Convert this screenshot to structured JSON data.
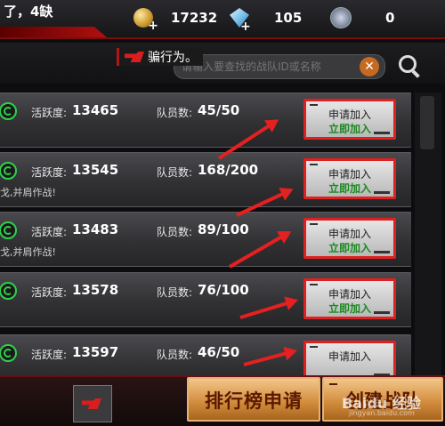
{
  "top": {
    "notice": "了，4缺",
    "gold": "17232",
    "diamond": "105",
    "medal": "0"
  },
  "search": {
    "warning": "骗行为。",
    "placeholder": "请输入要查找的战队ID或名称"
  },
  "rows": [
    {
      "activity_label": "活跃度:",
      "activity": "13465",
      "members_label": "队员数:",
      "members": "45/50",
      "desc": "",
      "apply": "申请加入",
      "join": "立即加入"
    },
    {
      "activity_label": "活跃度:",
      "activity": "13545",
      "members_label": "队员数:",
      "members": "168/200",
      "desc": "戈,并肩作战!",
      "apply": "申请加入",
      "join": "立即加入"
    },
    {
      "activity_label": "活跃度:",
      "activity": "13483",
      "members_label": "队员数:",
      "members": "89/100",
      "desc": "戈,并肩作战!",
      "apply": "申请加入",
      "join": "立即加入"
    },
    {
      "activity_label": "活跃度:",
      "activity": "13578",
      "members_label": "队员数:",
      "members": "76/100",
      "desc": "",
      "apply": "申请加入",
      "join": "立即加入"
    },
    {
      "activity_label": "活跃度:",
      "activity": "13597",
      "members_label": "队员数:",
      "members": "46/50",
      "desc": "",
      "apply": "申请加入",
      "join": ""
    }
  ],
  "bottom": {
    "rank_button": "排行榜申请",
    "create_button": "创建战队",
    "watermark": "Baidu 经验",
    "watermark_sub": "jingyan.baidu.com"
  },
  "colors": {
    "accent": "#e02020",
    "join_text": "#1a8a20",
    "button_gold": "#d08a3a"
  },
  "icons": {
    "gold": "coin-icon",
    "diamond": "gem-icon",
    "medal": "badge-icon",
    "search": "search-icon",
    "clear": "close-icon",
    "clan": "clan-icon",
    "cf": "cf-logo-icon"
  }
}
